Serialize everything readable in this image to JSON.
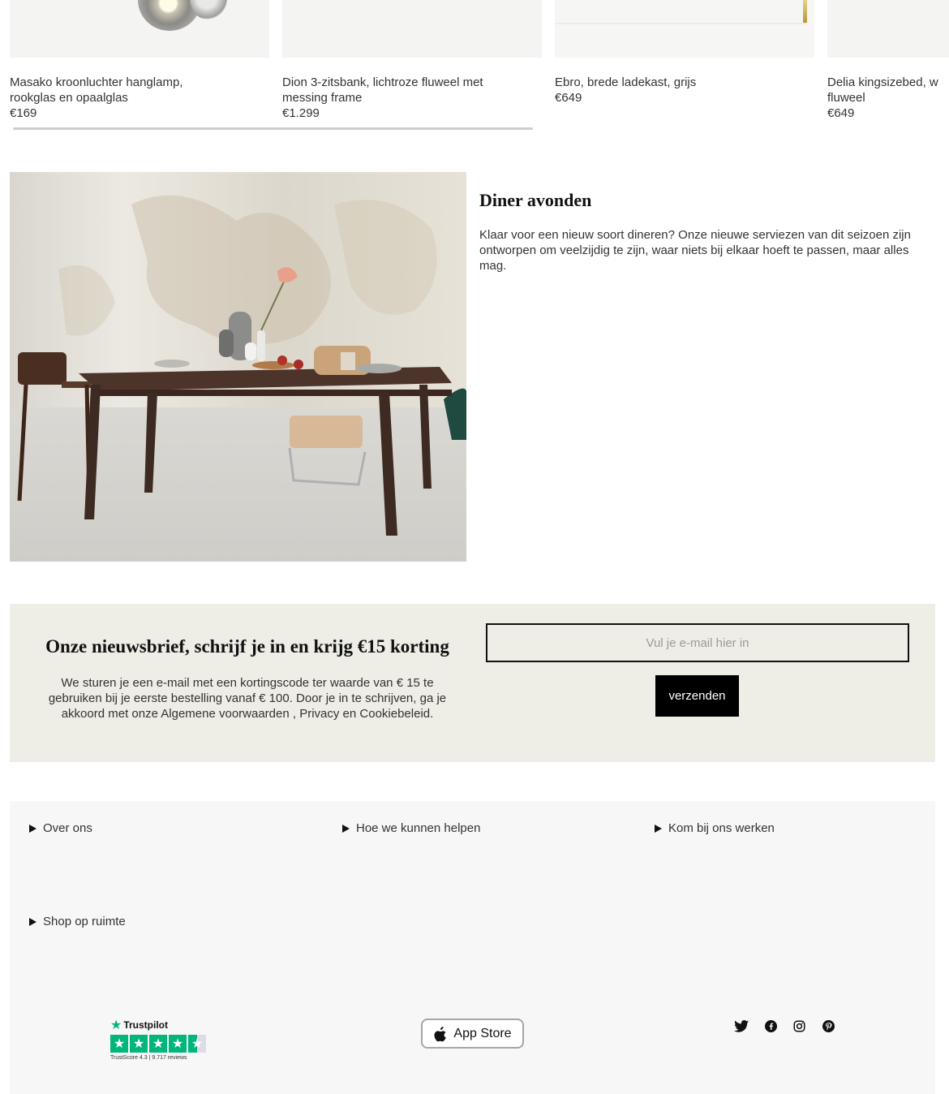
{
  "products": [
    {
      "name": "Masako kroonluchter hanglamp, rookglas en opaalglas",
      "price": "€169"
    },
    {
      "name": "Dion 3-zitsbank, lichtroze fluweel met messing frame",
      "price": "€1.299"
    },
    {
      "name": "Ebro, brede ladekast, grijs",
      "price": "€649"
    },
    {
      "name": "Delia kingsizebed, w fluweel",
      "price": "€649"
    }
  ],
  "feature": {
    "title": "Diner avonden",
    "text": "Klaar voor een nieuw soort dineren? Onze nieuwe serviezen van dit seizoen zijn ontworpen om veelzijdig te zijn, waar niets bij elkaar hoeft te passen, maar alles mag."
  },
  "newsletter": {
    "title": "Onze nieuwsbrief, schrijf je in en krijg €15 korting",
    "text": "We sturen je een e-mail met een kortingscode ter waarde van € 15 te gebruiken bij je eerste bestelling vanaf € 100. Door je in te schrijven, ga je akkoord met onze Algemene voorwaarden , Privacy en Cookiebeleid.",
    "placeholder": "Vul je e-mail hier in",
    "button": "verzenden"
  },
  "footer": {
    "accordions": [
      "Over ons",
      "Hoe we kunnen helpen",
      "Kom bij ons werken",
      "Shop op ruimte"
    ],
    "trustpilot": {
      "brand": "Trustpilot",
      "score_text": "TrustScore 4.3 | 9.717 reviews",
      "rating": 4.3
    },
    "appstore": {
      "label": "App Store",
      "icon": "apple-icon"
    },
    "social": [
      "twitter-icon",
      "facebook-icon",
      "instagram-icon",
      "pinterest-icon"
    ]
  },
  "colors": {
    "newsletter_bg": "#eeede6",
    "footer_bg": "#f7f7f7",
    "trustpilot_green": "#00b67a",
    "button_bg": "#000000"
  }
}
